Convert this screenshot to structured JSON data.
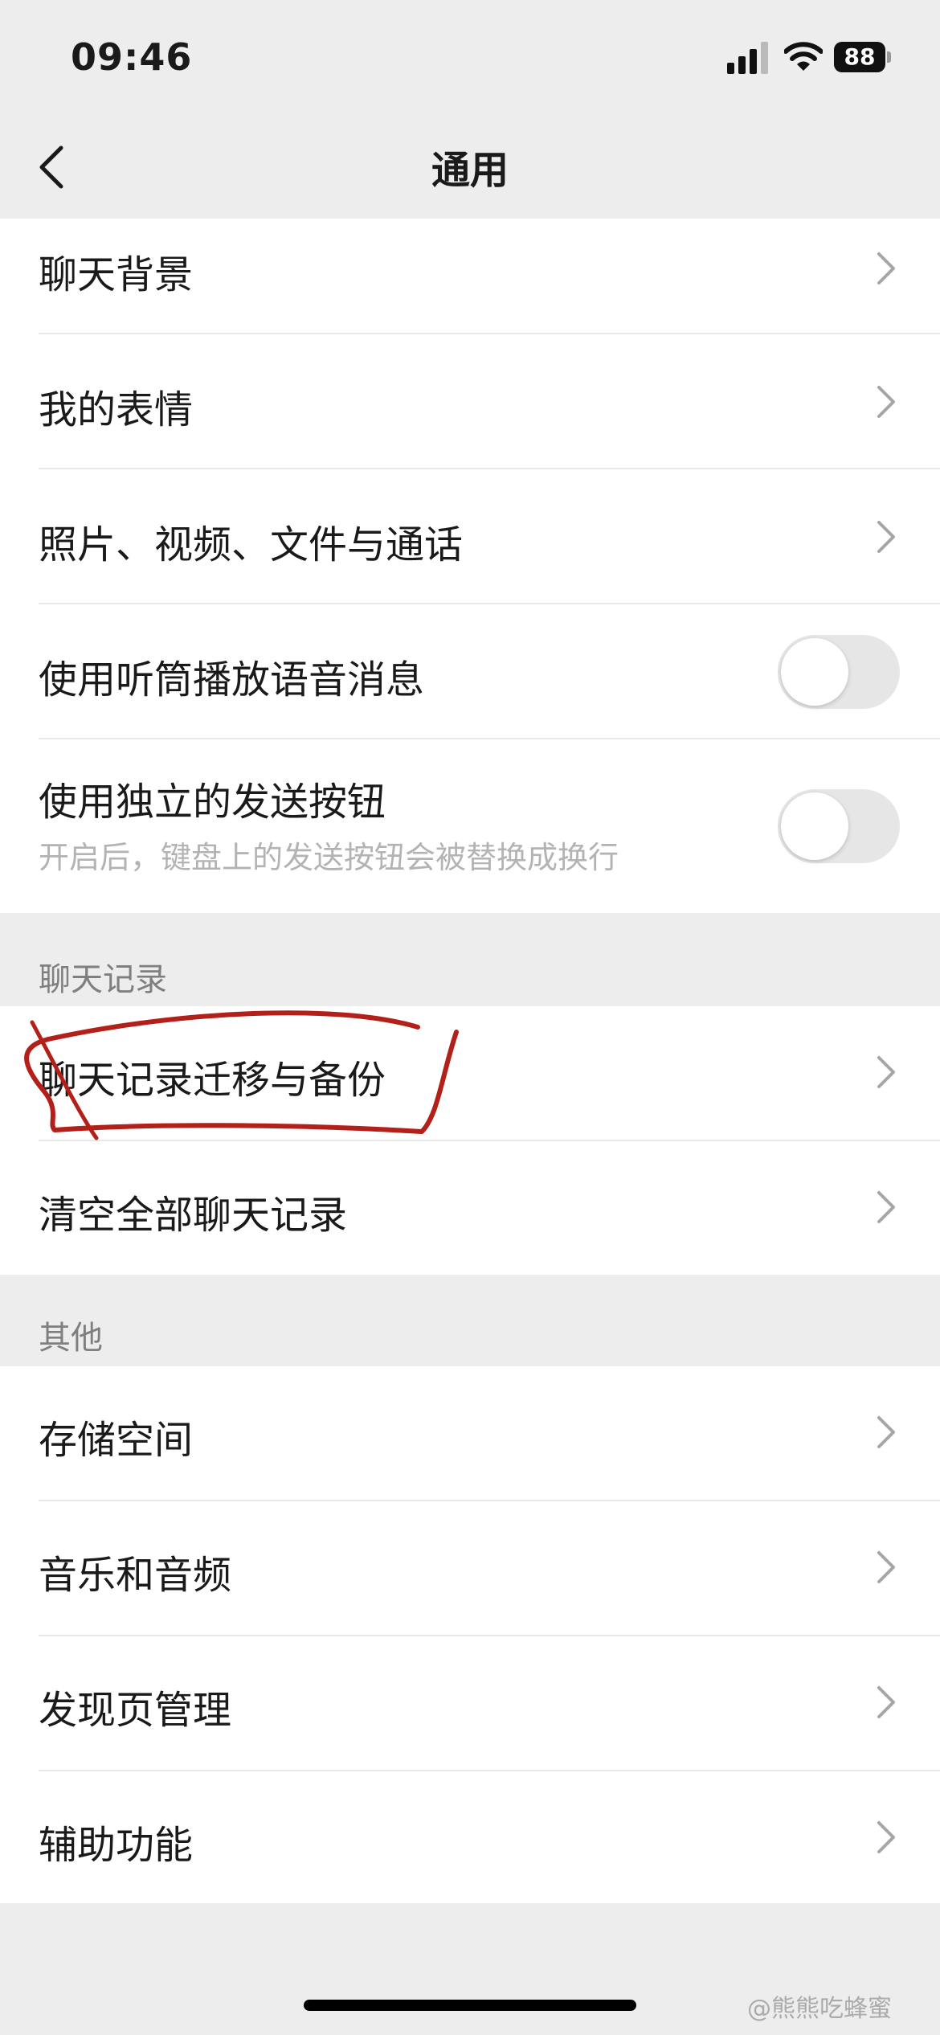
{
  "status_bar": {
    "time": "09:46",
    "battery": "88"
  },
  "nav": {
    "title": "通用"
  },
  "general_items": {
    "chat_background": "聊天背景",
    "my_stickers": "我的表情",
    "media_files": "照片、视频、文件与通话",
    "earpiece": "使用听筒播放语音消息",
    "earpiece_on": false,
    "send_button": "使用独立的发送按钮",
    "send_button_desc": "开启后，键盘上的发送按钮会被替换成换行",
    "send_button_on": false
  },
  "chat_history": {
    "header": "聊天记录",
    "migrate_backup": "聊天记录迁移与备份",
    "clear_all": "清空全部聊天记录"
  },
  "other": {
    "header": "其他",
    "storage": "存储空间",
    "music_audio": "音乐和音频",
    "discover_manage": "发现页管理",
    "accessibility": "辅助功能"
  },
  "watermark": "@熊熊吃蜂蜜",
  "colors": {
    "annotation": "#b3201a",
    "toggle_off": "#e6e6e6",
    "section_bg": "#ededed"
  }
}
